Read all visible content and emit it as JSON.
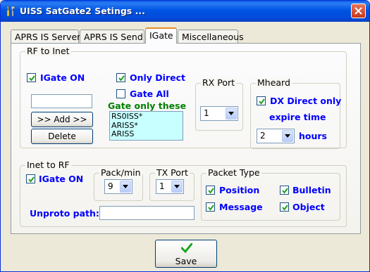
{
  "window": {
    "title": "UISS SatGate2 Setings ..."
  },
  "tabs": [
    {
      "label": "APRS IS Server"
    },
    {
      "label": "APRS IS Send"
    },
    {
      "label": "IGate"
    },
    {
      "label": "Miscellaneous"
    }
  ],
  "rf_to_inet": {
    "legend": "RF to Inet",
    "igate_on": {
      "label": "IGate ON",
      "checked": true
    },
    "only_direct": {
      "label": "Only Direct",
      "checked": true
    },
    "gate_all": {
      "label": "Gate All",
      "checked": false
    },
    "gate_only_label": "Gate only these",
    "callsign_input": "",
    "add_button": ">> Add >>",
    "delete_button": "Delete",
    "gate_list": [
      "RS0ISS*",
      "ARISS*",
      "ARISS"
    ]
  },
  "rx_port": {
    "legend": "RX Port",
    "value": "1"
  },
  "mheard": {
    "legend": "Mheard",
    "dx_direct_only": {
      "label": "DX Direct only",
      "checked": true
    },
    "expire_time_label": "expire time",
    "hours_value": "2",
    "hours_label": "hours"
  },
  "inet_to_rf": {
    "legend": "Inet to RF",
    "igate_on": {
      "label": "IGate ON",
      "checked": true
    },
    "unproto_label": "Unproto path:",
    "unproto_value": ""
  },
  "pack_min": {
    "legend": "Pack/min",
    "value": "9"
  },
  "tx_port": {
    "legend": "TX Port",
    "value": "1"
  },
  "packet_type": {
    "legend": "Packet Type",
    "position": {
      "label": "Position",
      "checked": true
    },
    "bulletin": {
      "label": "Bulletin",
      "checked": true
    },
    "message": {
      "label": "Message",
      "checked": true
    },
    "object": {
      "label": "Object",
      "checked": true
    }
  },
  "save_button": "Save",
  "colors": {
    "title_bar": "#0054e3",
    "accent_blue": "#0000ff",
    "accent_green": "#008000",
    "list_bg": "#c8ffff"
  }
}
